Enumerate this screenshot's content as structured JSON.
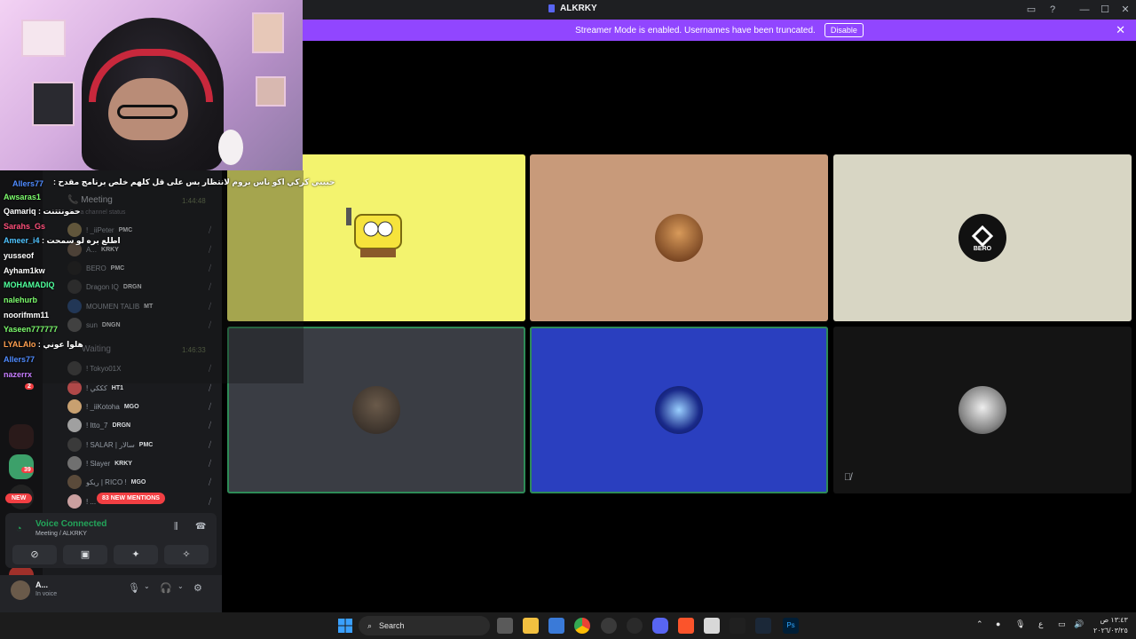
{
  "window": {
    "title": "ALKRKY"
  },
  "banner": {
    "text": "Streamer Mode is enabled. Usernames have been truncated.",
    "button": "Disable"
  },
  "chat_overlay": {
    "lines": [
      {
        "user": "",
        "msg": "حبيبي كركي اكو ناس بروم لانتظار بس على قل كلهم خلص برنامج مقدح",
        "color": "#ffffff"
      },
      {
        "user": "Allers77",
        "msg": "",
        "color": "#4f8bff"
      },
      {
        "user": "Awsaras1",
        "msg": "",
        "color": "#7cfc6c"
      },
      {
        "user": "Qamariq",
        "msg": "حمونتتنت",
        "color": "#ffffff"
      },
      {
        "user": "Sarahs_Gs",
        "msg": "",
        "color": "#ff4f7a"
      },
      {
        "user": "Ameer_i4",
        "msg": "اطلع بره لو سمحت",
        "color": "#4fc3ff"
      },
      {
        "user": "yusseof",
        "msg": "",
        "color": "#ffffff"
      },
      {
        "user": "Ayham1kw",
        "msg": "",
        "color": "#ffffff"
      },
      {
        "user": "MOHAMADIQ",
        "msg": "",
        "color": "#4fff9c"
      },
      {
        "user": "nalehurb",
        "msg": "",
        "color": "#7cfc6c"
      },
      {
        "user": "noorifmm11",
        "msg": "",
        "color": "#ffffff"
      },
      {
        "user": "Yaseen777777",
        "msg": "",
        "color": "#7cfc6c"
      },
      {
        "user": "LYALAlo",
        "msg": "هلوا عوني",
        "color": "#ff9f4f"
      },
      {
        "user": "Allers77",
        "msg": "",
        "color": "#4f8bff"
      },
      {
        "user": "nazerrx",
        "msg": "",
        "color": "#c77dff"
      }
    ]
  },
  "sidebar": {
    "channel_meeting": "Meeting",
    "meeting_time": "1:44:48",
    "channel_status_placeholder": "Set a channel status",
    "waiting_label": "Waiting",
    "waiting_time": "1:46:33",
    "voice_users": [
      {
        "name": "! _iiPeter",
        "tag": "PMC",
        "color": "#8a7a50"
      },
      {
        "name": "A...",
        "tag": "KRKY",
        "color": "#6a5a4a"
      },
      {
        "name": "BERO",
        "tag": "PMC",
        "color": "#222222"
      },
      {
        "name": "Dragon IQ",
        "tag": "DRGN",
        "color": "#3a3a3a"
      },
      {
        "name": "MOUMEN TALIB",
        "tag": "MT",
        "color": "#2a4a7a"
      },
      {
        "name": "sun",
        "tag": "DNGN",
        "color": "#5a5a5a"
      },
      {
        "name": "! Tokyo01X",
        "tag": "",
        "color": "#444444"
      },
      {
        "name": "! كككي",
        "tag": "HT1",
        "color": "#b04848"
      },
      {
        "name": "! _iiKotoha",
        "tag": "MGO",
        "color": "#c8a070"
      },
      {
        "name": "! Itto_7",
        "tag": "DRGN",
        "color": "#a0a0a0"
      },
      {
        "name": "! SALAR | سالار",
        "tag": "PMC",
        "color": "#3a3a3a"
      },
      {
        "name": "! Slayer",
        "tag": "KRKY",
        "color": "#707070"
      },
      {
        "name": "ريكو | RICO !",
        "tag": "MGO",
        "color": "#5a4a3a"
      },
      {
        "name": "! ...",
        "tag": "KRKY",
        "color": "#caa0a0"
      }
    ],
    "new_badge": "NEW",
    "mentions": "83 NEW MENTIONS",
    "server_badge": "39",
    "server_badge2": "2"
  },
  "voice": {
    "title": "Voice Connected",
    "subtitle": "Meeting / ALKRKY"
  },
  "user": {
    "name": "A...",
    "status": "In voice"
  },
  "tiles": [
    {
      "label": "spongebob",
      "bg": "#f3f36e"
    },
    {
      "label": "",
      "bg": "#c89a7a"
    },
    {
      "label": "BERO",
      "bg": "#d8d6c4"
    },
    {
      "label": "",
      "bg": "#3a3d44"
    },
    {
      "label": "",
      "bg": "#2a3fbf"
    },
    {
      "label": "",
      "bg": "#141414"
    }
  ],
  "taskbar": {
    "search": "Search",
    "lang": "ع",
    "time": "١٣:٤٣ ص",
    "date": "٢٠٢٦/٠٣/٢٥"
  },
  "colors": {
    "accent": "#9146ff",
    "discord": "#5865f2",
    "green": "#23a55a",
    "red": "#f23f43"
  }
}
